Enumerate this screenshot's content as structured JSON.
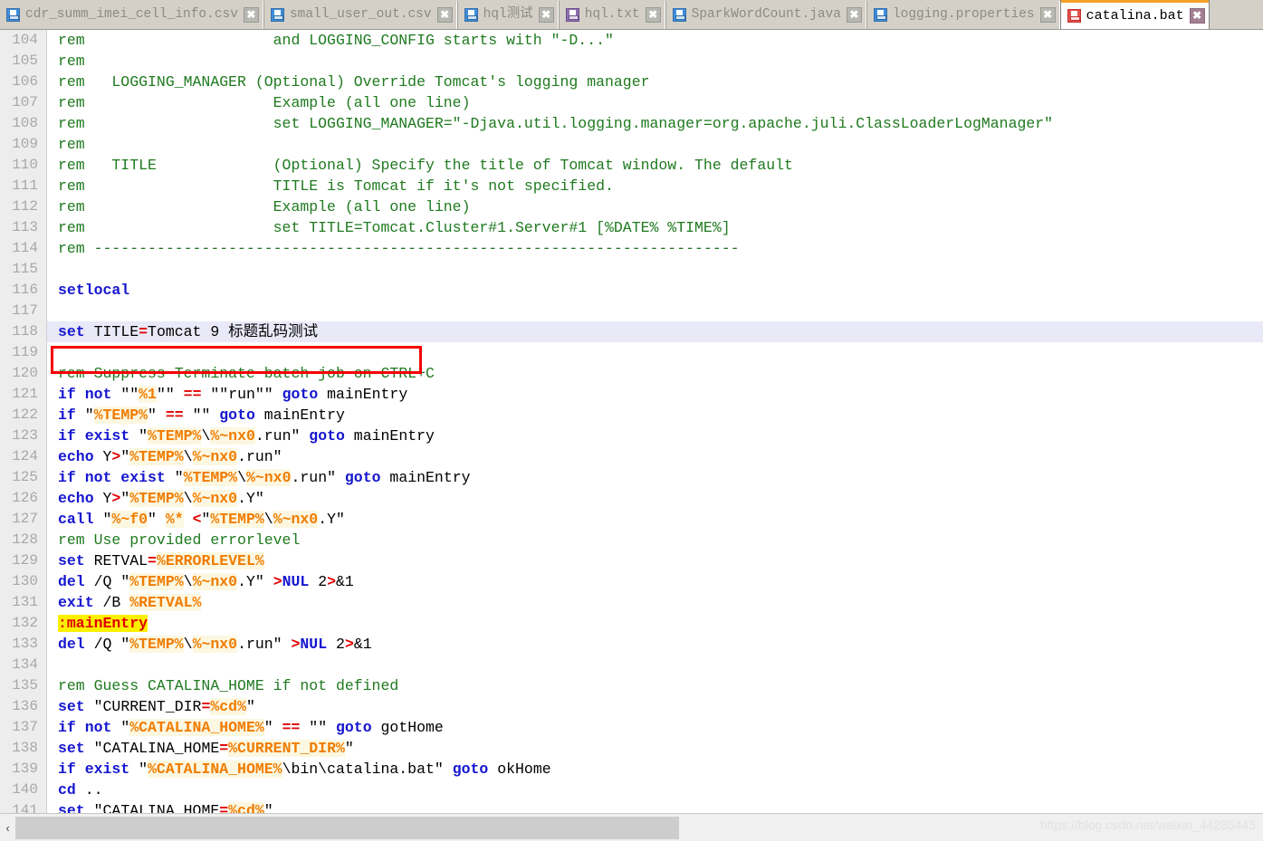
{
  "tabs": [
    {
      "label": "cdr_summ_imei_cell_info.csv",
      "icon": "floppy-disk-icon",
      "icon_color": "#3b8ede",
      "active": false,
      "close_label": "✖"
    },
    {
      "label": "small_user_out.csv",
      "icon": "floppy-disk-icon",
      "icon_color": "#3b8ede",
      "active": false,
      "close_label": "✖"
    },
    {
      "label": "hql测试",
      "icon": "floppy-disk-icon",
      "icon_color": "#3b8ede",
      "active": false,
      "close_label": "✖"
    },
    {
      "label": "hql.txt",
      "icon": "floppy-disk-icon",
      "icon_color": "#8d6fb0",
      "active": false,
      "close_label": "✖"
    },
    {
      "label": "SparkWordCount.java",
      "icon": "floppy-disk-icon",
      "icon_color": "#3b8ede",
      "active": false,
      "close_label": "✖"
    },
    {
      "label": "logging.properties",
      "icon": "floppy-disk-icon",
      "icon_color": "#3b8ede",
      "active": false,
      "close_label": "✖"
    },
    {
      "label": "catalina.bat",
      "icon": "floppy-disk-unsaved-icon",
      "icon_color": "#e45151",
      "active": true,
      "close_label": "✖"
    }
  ],
  "editor": {
    "first_line": 104,
    "current_line": 118,
    "annotation": {
      "type": "red-rectangle",
      "target_line": 118
    },
    "lines": [
      {
        "n": "104",
        "tokens": [
          {
            "t": "com",
            "s": "rem                     and LOGGING_CONFIG starts with \"-D...\""
          }
        ]
      },
      {
        "n": "105",
        "tokens": [
          {
            "t": "com",
            "s": "rem"
          }
        ]
      },
      {
        "n": "106",
        "tokens": [
          {
            "t": "com",
            "s": "rem   LOGGING_MANAGER (Optional) Override Tomcat's logging manager"
          }
        ]
      },
      {
        "n": "107",
        "tokens": [
          {
            "t": "com",
            "s": "rem                     Example (all one line)"
          }
        ]
      },
      {
        "n": "108",
        "tokens": [
          {
            "t": "com",
            "s": "rem                     set LOGGING_MANAGER=\"-Djava.util.logging.manager=org.apache.juli.ClassLoaderLogManager\""
          }
        ]
      },
      {
        "n": "109",
        "tokens": [
          {
            "t": "com",
            "s": "rem"
          }
        ]
      },
      {
        "n": "110",
        "tokens": [
          {
            "t": "com",
            "s": "rem   TITLE             (Optional) Specify the title of Tomcat window. The default"
          }
        ]
      },
      {
        "n": "111",
        "tokens": [
          {
            "t": "com",
            "s": "rem                     TITLE is Tomcat if it's not specified."
          }
        ]
      },
      {
        "n": "112",
        "tokens": [
          {
            "t": "com",
            "s": "rem                     Example (all one line)"
          }
        ]
      },
      {
        "n": "113",
        "tokens": [
          {
            "t": "com",
            "s": "rem                     set TITLE=Tomcat.Cluster#1.Server#1 [%DATE% %TIME%]"
          }
        ]
      },
      {
        "n": "114",
        "tokens": [
          {
            "t": "com",
            "s": "rem ------------------------------------------------------------------------"
          }
        ]
      },
      {
        "n": "115",
        "tokens": []
      },
      {
        "n": "116",
        "tokens": [
          {
            "t": "kw",
            "s": "setlocal"
          }
        ]
      },
      {
        "n": "117",
        "tokens": []
      },
      {
        "n": "118",
        "cur": true,
        "tokens": [
          {
            "t": "kw",
            "s": "set"
          },
          {
            "t": "txt",
            "s": " TITLE"
          },
          {
            "t": "op",
            "s": "="
          },
          {
            "t": "txt",
            "s": "Tomcat 9 标题乱码测试"
          }
        ]
      },
      {
        "n": "119",
        "tokens": []
      },
      {
        "n": "120",
        "tokens": [
          {
            "t": "com",
            "s": "rem Suppress Terminate batch job on CTRL+C"
          }
        ]
      },
      {
        "n": "121",
        "tokens": [
          {
            "t": "kw",
            "s": "if not"
          },
          {
            "t": "txt",
            "s": " \"\""
          },
          {
            "t": "var",
            "s": "%1"
          },
          {
            "t": "txt",
            "s": "\"\" "
          },
          {
            "t": "op",
            "s": "=="
          },
          {
            "t": "txt",
            "s": " \"\"run\"\" "
          },
          {
            "t": "kw",
            "s": "goto"
          },
          {
            "t": "txt",
            "s": " mainEntry"
          }
        ]
      },
      {
        "n": "122",
        "tokens": [
          {
            "t": "kw",
            "s": "if"
          },
          {
            "t": "txt",
            "s": " \""
          },
          {
            "t": "var",
            "s": "%TEMP%"
          },
          {
            "t": "txt",
            "s": "\" "
          },
          {
            "t": "op",
            "s": "=="
          },
          {
            "t": "txt",
            "s": " \"\" "
          },
          {
            "t": "kw",
            "s": "goto"
          },
          {
            "t": "txt",
            "s": " mainEntry"
          }
        ]
      },
      {
        "n": "123",
        "tokens": [
          {
            "t": "kw",
            "s": "if exist"
          },
          {
            "t": "txt",
            "s": " \""
          },
          {
            "t": "var",
            "s": "%TEMP%"
          },
          {
            "t": "txt",
            "s": "\\"
          },
          {
            "t": "var",
            "s": "%~nx0"
          },
          {
            "t": "txt",
            "s": ".run\" "
          },
          {
            "t": "kw",
            "s": "goto"
          },
          {
            "t": "txt",
            "s": " mainEntry"
          }
        ]
      },
      {
        "n": "124",
        "tokens": [
          {
            "t": "kw",
            "s": "echo"
          },
          {
            "t": "txt",
            "s": " Y"
          },
          {
            "t": "op",
            "s": ">"
          },
          {
            "t": "txt",
            "s": "\""
          },
          {
            "t": "var",
            "s": "%TEMP%"
          },
          {
            "t": "txt",
            "s": "\\"
          },
          {
            "t": "var",
            "s": "%~nx0"
          },
          {
            "t": "txt",
            "s": ".run\""
          }
        ]
      },
      {
        "n": "125",
        "tokens": [
          {
            "t": "kw",
            "s": "if not exist"
          },
          {
            "t": "txt",
            "s": " \""
          },
          {
            "t": "var",
            "s": "%TEMP%"
          },
          {
            "t": "txt",
            "s": "\\"
          },
          {
            "t": "var",
            "s": "%~nx0"
          },
          {
            "t": "txt",
            "s": ".run\" "
          },
          {
            "t": "kw",
            "s": "goto"
          },
          {
            "t": "txt",
            "s": " mainEntry"
          }
        ]
      },
      {
        "n": "126",
        "tokens": [
          {
            "t": "kw",
            "s": "echo"
          },
          {
            "t": "txt",
            "s": " Y"
          },
          {
            "t": "op",
            "s": ">"
          },
          {
            "t": "txt",
            "s": "\""
          },
          {
            "t": "var",
            "s": "%TEMP%"
          },
          {
            "t": "txt",
            "s": "\\"
          },
          {
            "t": "var",
            "s": "%~nx0"
          },
          {
            "t": "txt",
            "s": ".Y\""
          }
        ]
      },
      {
        "n": "127",
        "tokens": [
          {
            "t": "kw",
            "s": "call"
          },
          {
            "t": "txt",
            "s": " \""
          },
          {
            "t": "var",
            "s": "%~f0"
          },
          {
            "t": "txt",
            "s": "\" "
          },
          {
            "t": "var",
            "s": "%*"
          },
          {
            "t": "txt",
            "s": " "
          },
          {
            "t": "op",
            "s": "<"
          },
          {
            "t": "txt",
            "s": "\""
          },
          {
            "t": "var",
            "s": "%TEMP%"
          },
          {
            "t": "txt",
            "s": "\\"
          },
          {
            "t": "var",
            "s": "%~nx0"
          },
          {
            "t": "txt",
            "s": ".Y\""
          }
        ]
      },
      {
        "n": "128",
        "tokens": [
          {
            "t": "com",
            "s": "rem Use provided errorlevel"
          }
        ]
      },
      {
        "n": "129",
        "tokens": [
          {
            "t": "kw",
            "s": "set"
          },
          {
            "t": "txt",
            "s": " RETVAL"
          },
          {
            "t": "op",
            "s": "="
          },
          {
            "t": "var",
            "s": "%ERRORLEVEL%"
          }
        ]
      },
      {
        "n": "130",
        "tokens": [
          {
            "t": "kw",
            "s": "del"
          },
          {
            "t": "txt",
            "s": " /Q \""
          },
          {
            "t": "var",
            "s": "%TEMP%"
          },
          {
            "t": "txt",
            "s": "\\"
          },
          {
            "t": "var",
            "s": "%~nx0"
          },
          {
            "t": "txt",
            "s": ".Y\" "
          },
          {
            "t": "op",
            "s": ">"
          },
          {
            "t": "kw",
            "s": "NUL"
          },
          {
            "t": "txt",
            "s": " 2"
          },
          {
            "t": "op",
            "s": ">"
          },
          {
            "t": "txt",
            "s": "&1"
          }
        ]
      },
      {
        "n": "131",
        "tokens": [
          {
            "t": "kw",
            "s": "exit"
          },
          {
            "t": "txt",
            "s": " /B "
          },
          {
            "t": "var",
            "s": "%RETVAL%"
          }
        ]
      },
      {
        "n": "132",
        "tokens": [
          {
            "t": "lbl",
            "s": ":mainEntry"
          }
        ]
      },
      {
        "n": "133",
        "tokens": [
          {
            "t": "kw",
            "s": "del"
          },
          {
            "t": "txt",
            "s": " /Q \""
          },
          {
            "t": "var",
            "s": "%TEMP%"
          },
          {
            "t": "txt",
            "s": "\\"
          },
          {
            "t": "var",
            "s": "%~nx0"
          },
          {
            "t": "txt",
            "s": ".run\" "
          },
          {
            "t": "op",
            "s": ">"
          },
          {
            "t": "kw",
            "s": "NUL"
          },
          {
            "t": "txt",
            "s": " 2"
          },
          {
            "t": "op",
            "s": ">"
          },
          {
            "t": "txt",
            "s": "&1"
          }
        ]
      },
      {
        "n": "134",
        "tokens": []
      },
      {
        "n": "135",
        "tokens": [
          {
            "t": "com",
            "s": "rem Guess CATALINA_HOME if not defined"
          }
        ]
      },
      {
        "n": "136",
        "tokens": [
          {
            "t": "kw",
            "s": "set"
          },
          {
            "t": "txt",
            "s": " \"CURRENT_DIR"
          },
          {
            "t": "op",
            "s": "="
          },
          {
            "t": "var",
            "s": "%cd%"
          },
          {
            "t": "txt",
            "s": "\""
          }
        ]
      },
      {
        "n": "137",
        "tokens": [
          {
            "t": "kw",
            "s": "if not"
          },
          {
            "t": "txt",
            "s": " \""
          },
          {
            "t": "var",
            "s": "%CATALINA_HOME%"
          },
          {
            "t": "txt",
            "s": "\" "
          },
          {
            "t": "op",
            "s": "=="
          },
          {
            "t": "txt",
            "s": " \"\" "
          },
          {
            "t": "kw",
            "s": "goto"
          },
          {
            "t": "txt",
            "s": " gotHome"
          }
        ]
      },
      {
        "n": "138",
        "tokens": [
          {
            "t": "kw",
            "s": "set"
          },
          {
            "t": "txt",
            "s": " \"CATALINA_HOME"
          },
          {
            "t": "op",
            "s": "="
          },
          {
            "t": "var",
            "s": "%CURRENT_DIR%"
          },
          {
            "t": "txt",
            "s": "\""
          }
        ]
      },
      {
        "n": "139",
        "tokens": [
          {
            "t": "kw",
            "s": "if exist"
          },
          {
            "t": "txt",
            "s": " \""
          },
          {
            "t": "var",
            "s": "%CATALINA_HOME%"
          },
          {
            "t": "txt",
            "s": "\\bin\\catalina.bat\" "
          },
          {
            "t": "kw",
            "s": "goto"
          },
          {
            "t": "txt",
            "s": " okHome"
          }
        ]
      },
      {
        "n": "140",
        "tokens": [
          {
            "t": "kw",
            "s": "cd"
          },
          {
            "t": "txt",
            "s": " .."
          }
        ]
      },
      {
        "n": "141",
        "tokens": [
          {
            "t": "kw",
            "s": "set"
          },
          {
            "t": "txt",
            "s": " \"CATALINA HOME"
          },
          {
            "t": "op",
            "s": "="
          },
          {
            "t": "var",
            "s": "%cd%"
          },
          {
            "t": "txt",
            "s": "\""
          }
        ]
      }
    ]
  },
  "scrollbar": {
    "left_arrow": "‹",
    "orientation": "horizontal"
  },
  "watermark": "https://blog.csdn.net/weixin_44285445"
}
